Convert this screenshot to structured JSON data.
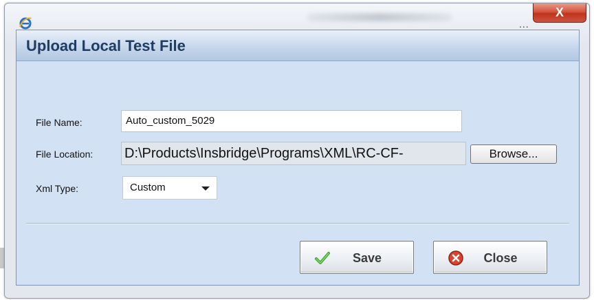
{
  "titlebar": {
    "overflow_label": "...",
    "close_label": "X"
  },
  "dialog": {
    "title": "Upload Local Test File"
  },
  "form": {
    "file_name": {
      "label": "File Name:",
      "value": "Auto_custom_5029"
    },
    "file_location": {
      "label": "File Location:",
      "value": "D:\\Products\\Insbridge\\Programs\\XML\\RC-CF-"
    },
    "browse_label": "Browse...",
    "xml_type": {
      "label": "Xml Type:",
      "value": "Custom"
    }
  },
  "actions": {
    "save_label": "Save",
    "close_label": "Close"
  },
  "colors": {
    "panel_bg": "#d3e1f4",
    "title_color": "#1f3c63",
    "close_red": "#c0341c"
  }
}
